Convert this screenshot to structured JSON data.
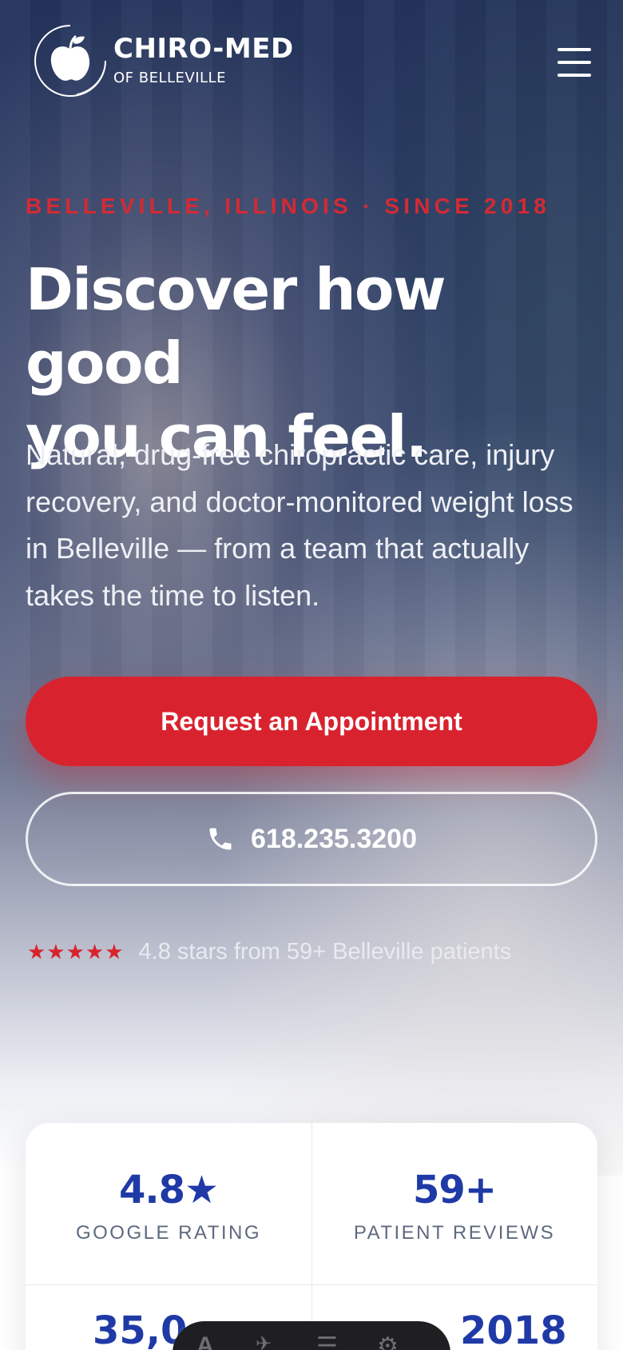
{
  "header": {
    "logo_title": "CHIRO-MED",
    "logo_subtitle": "OF BELLEVILLE",
    "menu_icon": "hamburger-menu-icon"
  },
  "hero": {
    "eyebrow": "BELLEVILLE, ILLINOIS · SINCE 2018",
    "headline_line1": "Discover how good",
    "headline_line2": "you can feel.",
    "lede": "Natural, drug-free chiropractic care, injury recovery, and doctor-monitored weight loss in Belleville — from a team that actually takes the time to listen.",
    "primary_cta": "Request an Appointment",
    "phone_cta": "618.235.3200",
    "stars": "★★★★★",
    "rating_text": "4.8 stars from 59+ Belleville patients"
  },
  "stats": {
    "items": [
      {
        "value": "4.8★",
        "label": "GOOGLE RATING"
      },
      {
        "value": "59+",
        "label": "PATIENT REVIEWS"
      }
    ],
    "partial_left": "35,0",
    "partial_right": "2018"
  },
  "colors": {
    "accent_red": "#d8232f",
    "brand_blue": "#1f3aa6",
    "hero_navy": "#24345c"
  }
}
